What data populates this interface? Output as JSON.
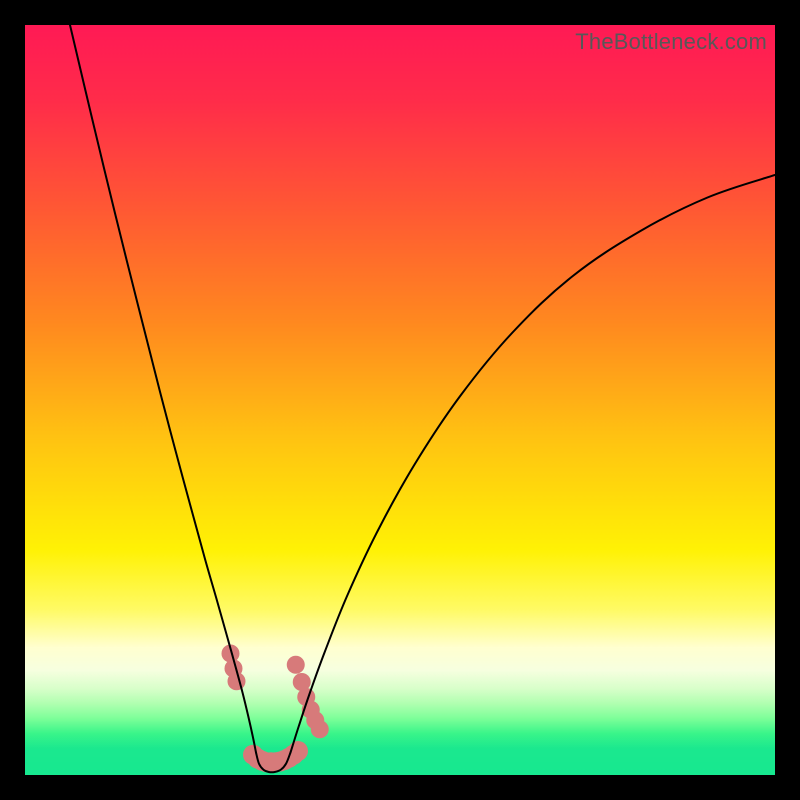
{
  "watermark": "TheBottleneck.com",
  "chart_data": {
    "type": "line",
    "title": "",
    "xlabel": "",
    "ylabel": "",
    "xlim": [
      0,
      100
    ],
    "ylim": [
      0,
      100
    ],
    "grid": false,
    "background_gradient_stops": [
      {
        "pos": 0.0,
        "color": "#ff1a55"
      },
      {
        "pos": 0.1,
        "color": "#ff2c4a"
      },
      {
        "pos": 0.25,
        "color": "#ff5a33"
      },
      {
        "pos": 0.4,
        "color": "#ff8a1f"
      },
      {
        "pos": 0.55,
        "color": "#ffc312"
      },
      {
        "pos": 0.7,
        "color": "#fff205"
      },
      {
        "pos": 0.78,
        "color": "#fffb66"
      },
      {
        "pos": 0.83,
        "color": "#ffffd0"
      },
      {
        "pos": 0.86,
        "color": "#f7ffe0"
      },
      {
        "pos": 0.885,
        "color": "#d8ffca"
      },
      {
        "pos": 0.905,
        "color": "#b0ffb0"
      },
      {
        "pos": 0.925,
        "color": "#7cff99"
      },
      {
        "pos": 0.945,
        "color": "#39f58a"
      },
      {
        "pos": 0.965,
        "color": "#1be88f"
      },
      {
        "pos": 1.0,
        "color": "#17e890"
      }
    ],
    "series": [
      {
        "name": "left-curve",
        "color": "#000000",
        "width": 2,
        "x": [
          6.0,
          9.0,
          12.0,
          15.0,
          18.0,
          20.0,
          22.0,
          24.0,
          25.5,
          26.8,
          28.0,
          29.0,
          29.8,
          30.4,
          30.8
        ],
        "values": [
          100.0,
          87.3,
          74.9,
          62.9,
          51.1,
          43.5,
          36.1,
          28.8,
          23.6,
          19.0,
          14.7,
          11.0,
          7.7,
          5.0,
          3.0
        ]
      },
      {
        "name": "right-curve",
        "color": "#000000",
        "width": 2,
        "x": [
          35.4,
          36.5,
          38.0,
          40.0,
          43.0,
          47.0,
          52.0,
          58.0,
          65.0,
          73.0,
          82.0,
          91.0,
          100.0
        ],
        "values": [
          3.0,
          6.5,
          11.0,
          16.5,
          24.0,
          32.5,
          41.5,
          50.5,
          59.0,
          66.5,
          72.5,
          77.0,
          80.0
        ]
      },
      {
        "name": "bottom-trough",
        "color": "#000000",
        "width": 2,
        "x": [
          30.8,
          31.2,
          31.8,
          32.5,
          33.3,
          34.1,
          34.8,
          35.4
        ],
        "values": [
          3.0,
          1.5,
          0.7,
          0.4,
          0.4,
          0.7,
          1.5,
          3.0
        ]
      }
    ],
    "markers": [
      {
        "name": "left-dots",
        "color": "#d77a7a",
        "radius": 9,
        "x": [
          27.4,
          27.8,
          28.2
        ],
        "values": [
          16.2,
          14.2,
          12.5
        ]
      },
      {
        "name": "right-dots",
        "color": "#d77a7a",
        "radius": 9,
        "x": [
          36.1,
          36.9,
          37.5,
          38.1,
          38.7,
          39.3
        ],
        "values": [
          14.7,
          12.4,
          10.4,
          8.7,
          7.3,
          6.1
        ]
      },
      {
        "name": "bottom-blob",
        "color": "#d77a7a",
        "radius": 10,
        "x": [
          30.4,
          31.0,
          31.6,
          32.2,
          32.8,
          33.4,
          34.0,
          34.6,
          35.2,
          35.8,
          36.4
        ],
        "values": [
          2.7,
          2.2,
          1.9,
          1.7,
          1.7,
          1.7,
          1.8,
          2.0,
          2.3,
          2.7,
          3.2
        ]
      }
    ]
  }
}
